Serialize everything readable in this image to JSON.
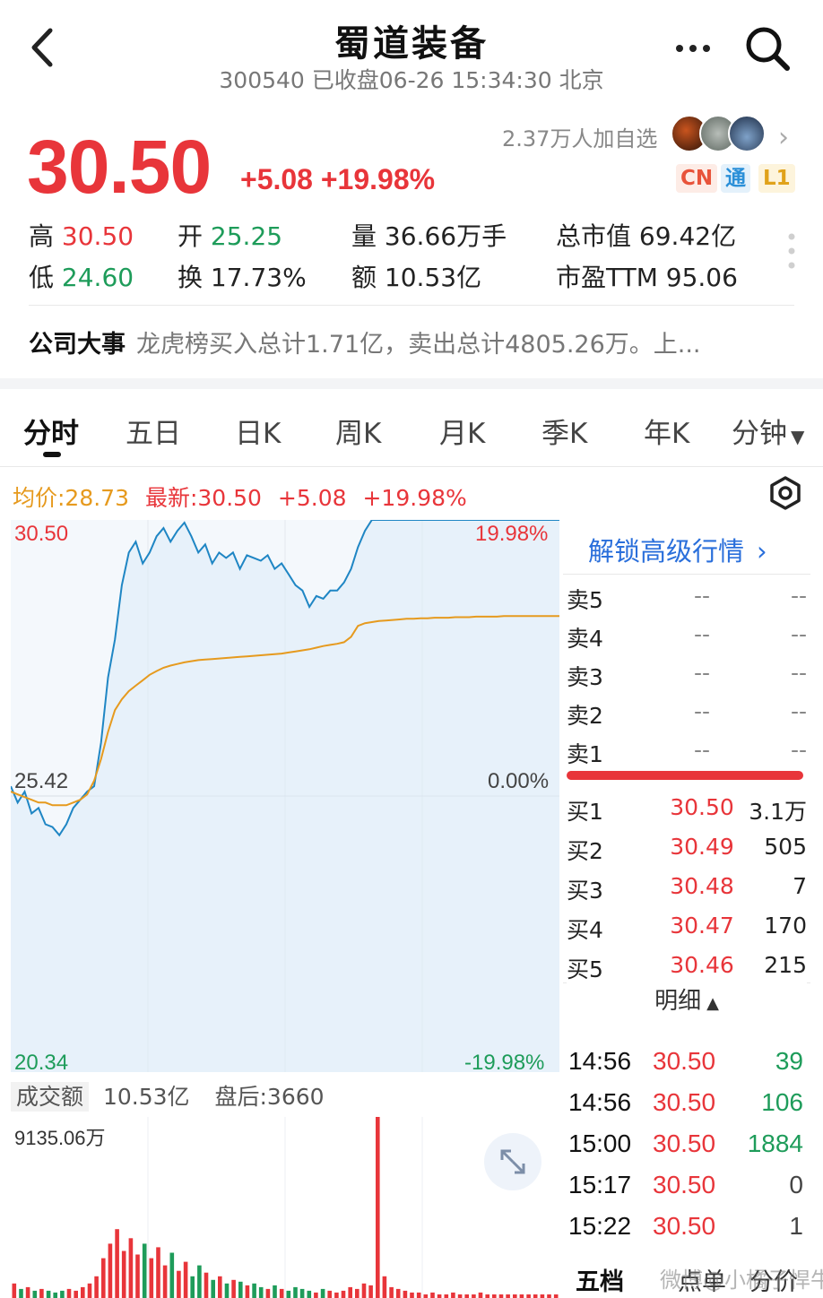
{
  "header": {
    "title": "蜀道装备",
    "subtitle": "300540 已收盘06-26 15:34:30 北京",
    "back_icon": "chevron-left-icon",
    "more_icon": "more-dots-icon",
    "search_icon": "search-icon"
  },
  "quote": {
    "price": "30.50",
    "change": "+5.08 +19.98%",
    "followers": "2.37万人加自选",
    "badges": [
      "CN",
      "通",
      "L1"
    ]
  },
  "stats": {
    "high_label": "高",
    "high_value": "30.50",
    "open_label": "开",
    "open_value": "25.25",
    "volume_label": "量",
    "volume_value": "36.66万手",
    "mcap_label": "总市值",
    "mcap_value": "69.42亿",
    "low_label": "低",
    "low_value": "24.60",
    "turnover_label": "换",
    "turnover_value": "17.73%",
    "amount_label": "额",
    "amount_value": "10.53亿",
    "pe_label": "市盈TTM",
    "pe_value": "95.06"
  },
  "events": {
    "label": "公司大事",
    "text": "龙虎榜买入总计1.71亿，卖出总计4805.26万。上..."
  },
  "tabs": [
    "分时",
    "五日",
    "日K",
    "周K",
    "月K",
    "季K",
    "年K",
    "分钟"
  ],
  "chart_info": {
    "avg": "均价:28.73",
    "latest": "最新:30.50",
    "change": "+5.08",
    "pct": "+19.98%"
  },
  "chart_data": {
    "type": "line",
    "series": [],
    "price_max": 30.5,
    "price_min": 20.34,
    "price_mid": 25.42,
    "pct_top": "19.98%",
    "pct_mid": "0.00%",
    "pct_bottom": "-19.98%",
    "price_line": [
      25.6,
      25.3,
      25.5,
      25.1,
      25.2,
      24.9,
      24.85,
      24.7,
      24.9,
      25.2,
      25.35,
      25.5,
      25.6,
      26.4,
      27.6,
      28.3,
      29.3,
      29.9,
      30.1,
      29.7,
      29.9,
      30.2,
      30.35,
      30.1,
      30.3,
      30.45,
      30.2,
      29.9,
      30.05,
      29.7,
      29.9,
      29.8,
      29.9,
      29.6,
      29.85,
      29.8,
      29.75,
      29.85,
      29.6,
      29.7,
      29.5,
      29.3,
      29.2,
      28.9,
      29.1,
      29.05,
      29.2,
      29.2,
      29.35,
      29.6,
      30.0,
      30.3,
      30.5,
      30.5,
      30.5,
      30.5,
      30.5,
      30.5,
      30.5,
      30.5,
      30.5,
      30.5,
      30.5,
      30.5,
      30.5,
      30.5,
      30.5,
      30.5,
      30.5,
      30.5,
      30.5,
      30.5,
      30.5,
      30.5,
      30.5,
      30.5,
      30.5,
      30.5,
      30.5,
      30.5
    ],
    "avg_line": [
      25.5,
      25.45,
      25.4,
      25.35,
      25.3,
      25.3,
      25.25,
      25.25,
      25.25,
      25.3,
      25.35,
      25.45,
      25.7,
      26.1,
      26.6,
      27.0,
      27.2,
      27.35,
      27.45,
      27.55,
      27.65,
      27.72,
      27.78,
      27.82,
      27.85,
      27.88,
      27.9,
      27.92,
      27.93,
      27.94,
      27.95,
      27.96,
      27.97,
      27.98,
      27.99,
      28.0,
      28.01,
      28.02,
      28.03,
      28.04,
      28.06,
      28.08,
      28.1,
      28.12,
      28.15,
      28.18,
      28.2,
      28.22,
      28.25,
      28.35,
      28.55,
      28.6,
      28.62,
      28.64,
      28.65,
      28.66,
      28.67,
      28.68,
      28.68,
      28.69,
      28.69,
      28.7,
      28.7,
      28.7,
      28.71,
      28.71,
      28.71,
      28.72,
      28.72,
      28.72,
      28.72,
      28.73,
      28.73,
      28.73,
      28.73,
      28.73,
      28.73,
      28.73,
      28.73,
      28.73
    ],
    "volume_label": "成交额",
    "volume_total": "10.53亿",
    "after_hours": "盘后:3660",
    "volume_max": "9135.06万",
    "volume_bars": [
      0.08,
      0.05,
      0.06,
      0.04,
      0.05,
      0.04,
      0.03,
      0.04,
      0.05,
      0.04,
      0.06,
      0.08,
      0.12,
      0.22,
      0.3,
      0.38,
      0.26,
      0.33,
      0.24,
      0.3,
      0.22,
      0.28,
      0.18,
      0.25,
      0.15,
      0.2,
      0.12,
      0.18,
      0.14,
      0.1,
      0.12,
      0.08,
      0.1,
      0.09,
      0.07,
      0.08,
      0.06,
      0.05,
      0.07,
      0.05,
      0.04,
      0.06,
      0.05,
      0.04,
      0.03,
      0.05,
      0.04,
      0.03,
      0.04,
      0.06,
      0.05,
      0.08,
      0.07,
      1.0,
      0.12,
      0.06,
      0.05,
      0.04,
      0.03,
      0.03,
      0.02,
      0.03,
      0.02,
      0.02,
      0.03,
      0.02,
      0.02,
      0.02,
      0.03,
      0.02,
      0.02,
      0.02,
      0.02,
      0.02,
      0.02,
      0.02,
      0.02,
      0.02,
      0.02,
      0.02
    ]
  },
  "orderbook": {
    "unlock": "解锁高级行情",
    "asks": [
      {
        "name": "卖5",
        "price": "--",
        "vol": "--"
      },
      {
        "name": "卖4",
        "price": "--",
        "vol": "--"
      },
      {
        "name": "卖3",
        "price": "--",
        "vol": "--"
      },
      {
        "name": "卖2",
        "price": "--",
        "vol": "--"
      },
      {
        "name": "卖1",
        "price": "--",
        "vol": "--"
      }
    ],
    "bids": [
      {
        "name": "买1",
        "price": "30.50",
        "vol": "3.1万"
      },
      {
        "name": "买2",
        "price": "30.49",
        "vol": "505"
      },
      {
        "name": "买3",
        "price": "30.48",
        "vol": "7"
      },
      {
        "name": "买4",
        "price": "30.47",
        "vol": "170"
      },
      {
        "name": "买5",
        "price": "30.46",
        "vol": "215"
      }
    ],
    "detail_label": "明细",
    "ticks": [
      {
        "time": "14:56",
        "price": "30.50",
        "vol": "39"
      },
      {
        "time": "14:56",
        "price": "30.50",
        "vol": "106"
      },
      {
        "time": "15:00",
        "price": "30.50",
        "vol": "1884"
      },
      {
        "time": "15:17",
        "price": "30.50",
        "vol": "0"
      },
      {
        "time": "15:22",
        "price": "30.50",
        "vol": "1"
      }
    ],
    "bottom_tabs": [
      "五档",
      "点单",
      "分价"
    ]
  },
  "watermark": "微博@小橘子悍牛",
  "colors": {
    "up": "#e8353a",
    "down": "#1e9c5a",
    "avg_line": "#e69a1e",
    "price_line": "#1f86c4",
    "link": "#2a6fdb"
  }
}
